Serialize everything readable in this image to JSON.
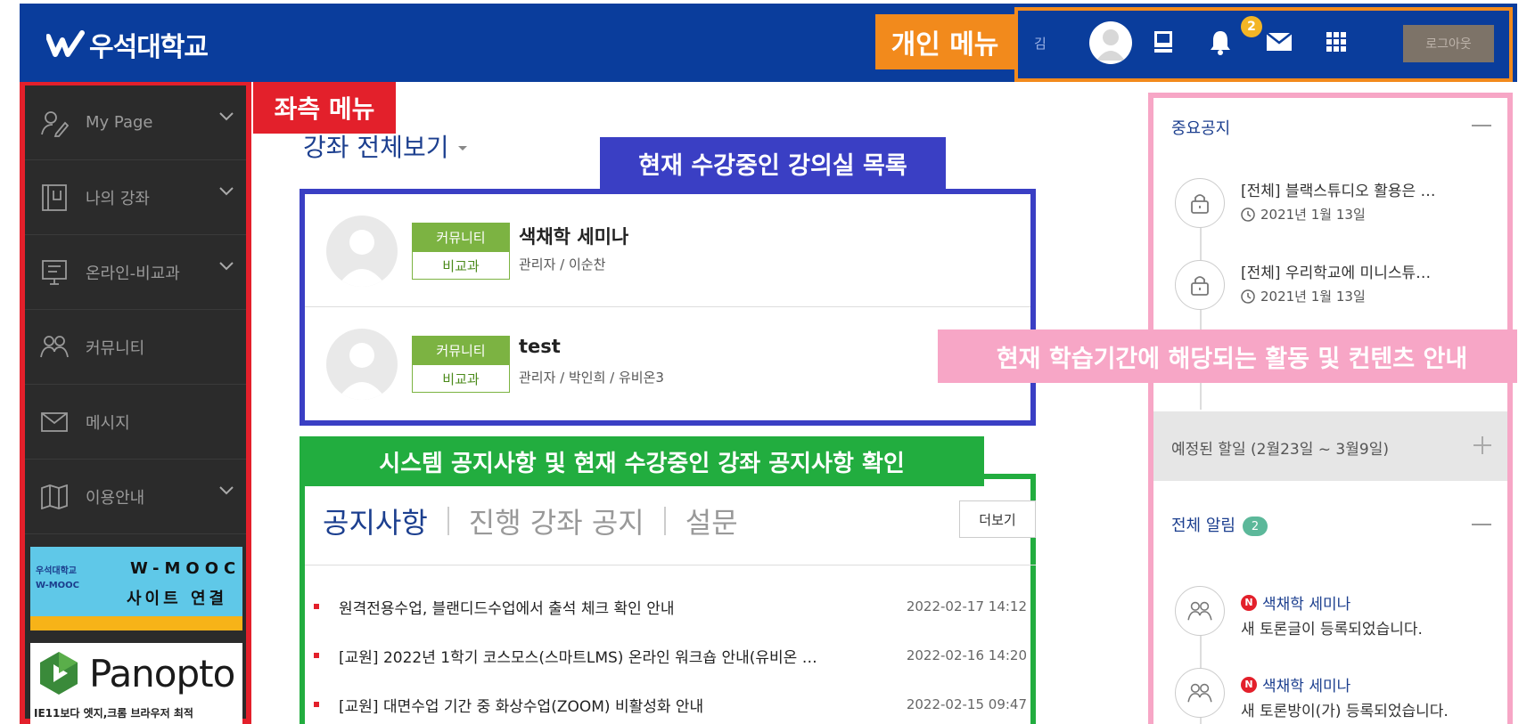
{
  "header": {
    "logo_text": "우석대학교",
    "user_name": "김",
    "notification_count": "2",
    "logout_label": "로그아웃"
  },
  "callouts": {
    "personal_menu": "개인 메뉴",
    "left_menu": "좌측 메뉴",
    "current_courses": "현재 수강중인 강의실 목록",
    "notices": "시스템 공지사항 및 현재 수강중인 강좌 공지사항 확인",
    "activities": "현재 학습기간에 해당되는 활동 및 컨텐츠 안내"
  },
  "sidebar": {
    "items": [
      {
        "label": "My Page",
        "icon": "user-edit-icon"
      },
      {
        "label": "나의 강좌",
        "icon": "book-icon"
      },
      {
        "label": "온라인-비교과",
        "icon": "monitor-icon"
      },
      {
        "label": "커뮤니티",
        "icon": "group-icon"
      },
      {
        "label": "메시지",
        "icon": "mail-icon"
      },
      {
        "label": "이용안내",
        "icon": "map-icon"
      }
    ],
    "wmooc_banner": {
      "small_line1": "우석대학교",
      "small_line2": "W-MOOC",
      "line1": "W-MOOC",
      "line2": "사이트 연결"
    },
    "panopto_banner": {
      "title": "Panopto",
      "subtitle": "IE11보다 엣지,크롬 브라우저 최적"
    }
  },
  "main": {
    "course_view_title": "강좌 전체보기",
    "courses": [
      {
        "tag_top": "커뮤니티",
        "tag_bottom": "비교과",
        "name": "색채학 세미나",
        "staff": "관리자 / 이순찬"
      },
      {
        "tag_top": "커뮤니티",
        "tag_bottom": "비교과",
        "name": "test",
        "staff": "관리자 / 박인희 / 유비온3"
      }
    ],
    "notice_tabs": [
      "공지사항",
      "진행 강좌 공지",
      "설문"
    ],
    "more_label": "더보기",
    "notices": [
      {
        "title": "원격전용수업, 블랜디드수업에서 출석 체크 확인 안내",
        "date": "2022-02-17 14:12"
      },
      {
        "title": "[교원] 2022년 1학기 코스모스(스마트LMS) 온라인 워크숍 안내(유비온 …",
        "date": "2022-02-16 14:20"
      },
      {
        "title": "[교원] 대면수업 기간 중 화상수업(ZOOM) 비활성화 안내",
        "date": "2022-02-15 09:47"
      }
    ]
  },
  "right_panel": {
    "important_title": "중요공지",
    "important_items": [
      {
        "title": "[전체] 블랙스튜디오 활용은 …",
        "date": "2021년 1월 13일"
      },
      {
        "title": "[전체] 우리학교에 미니스튜…",
        "date": "2021년 1월 13일"
      }
    ],
    "todo_text": "예정된 할일 (2월23일 ~ 3월9일)",
    "alerts_title": "전체 알림",
    "alerts_count": "2",
    "alerts": [
      {
        "new": "N",
        "course": "색채학 세미나",
        "message": "새 토론글이 등록되었습니다."
      },
      {
        "new": "N",
        "course": "색채학 세미나",
        "message": "새 토론방이(가) 등록되었습니다."
      }
    ]
  },
  "colors": {
    "header_bg": "#0a3d9c",
    "sidebar_bg": "#2b2b2b",
    "callout_orange": "#f28a1c",
    "callout_red": "#e3202b",
    "callout_blue": "#3a3fc4",
    "callout_green": "#22ad3f",
    "callout_pink": "#f7a6c6",
    "tag_green": "#7cb342"
  }
}
